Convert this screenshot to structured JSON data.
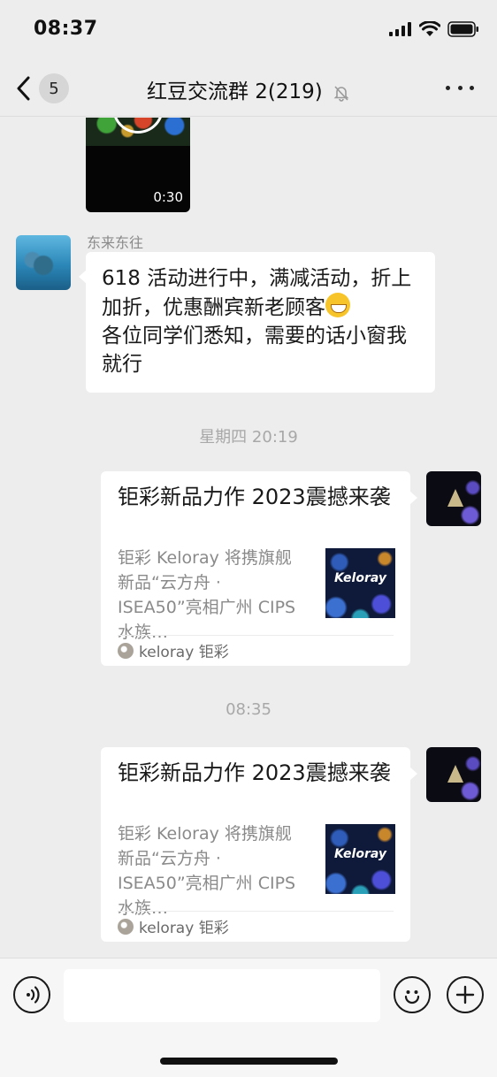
{
  "status_bar": {
    "time": "08:37",
    "icons": [
      "signal-icon",
      "wifi-icon",
      "battery-icon"
    ]
  },
  "nav": {
    "back_count": "5",
    "title": "红豆交流群 2(219)",
    "icons": [
      "back-chevron-icon",
      "mute-bell-icon",
      "more-icon"
    ]
  },
  "messages": {
    "video": {
      "duration": "0:30"
    },
    "text_msg": {
      "sender": "东来东往",
      "text": "618 活动进行中，满减活动，折上加折，优惠酬宾新老顾客",
      "text2": "各位同学们悉知，需要的话小窗我就行"
    },
    "timestamp1": "星期四 20:19",
    "card1": {
      "title": "钜彩新品力作 2023震撼来袭",
      "desc": "钜彩 Keloray 将携旗舰新品“云方舟 · ISEA50”亮相广州 CIPS 水族…",
      "thumb_brand": "Keloray",
      "source": "keloray 钜彩"
    },
    "timestamp2": "08:35",
    "card2": {
      "title": "钜彩新品力作 2023震撼来袭",
      "desc": "钜彩 Keloray 将携旗舰新品“云方舟 · ISEA50”亮相广州 CIPS 水族…",
      "thumb_brand": "Keloray",
      "source": "keloray 钜彩"
    }
  },
  "input_bar": {
    "input_value": "",
    "icons": [
      "voice-icon",
      "emoji-icon",
      "plus-icon"
    ]
  }
}
